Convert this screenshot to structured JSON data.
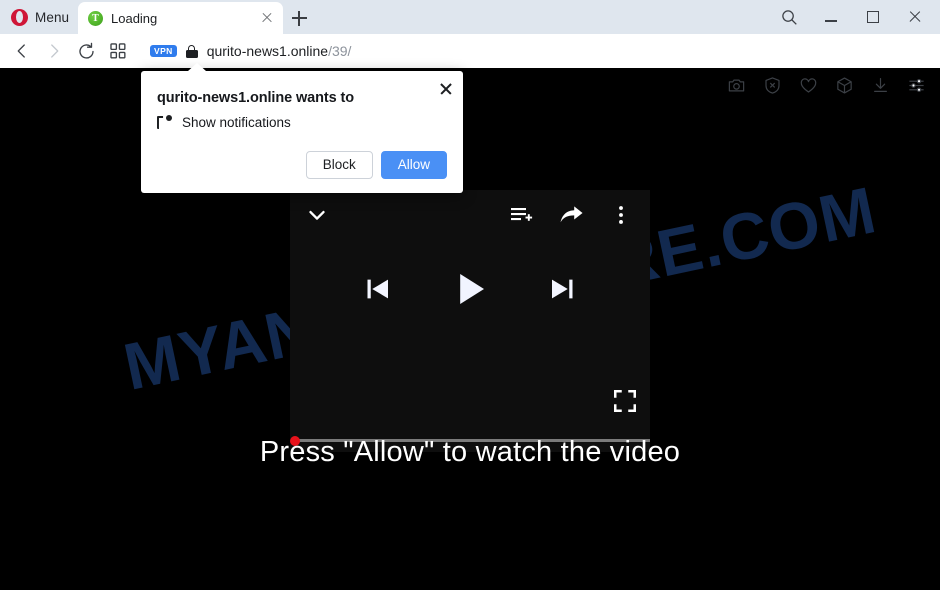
{
  "browser": {
    "name": "Opera",
    "menu_label": "Menu",
    "tab": {
      "title": "Loading",
      "favicon_letter": "T",
      "favicon_color": "#4caf28",
      "close_icon": "close-icon"
    },
    "new_tab_icon": "plus-icon",
    "window_controls": {
      "search_icon": "search-icon",
      "minimize_icon": "minimize-icon",
      "maximize_icon": "maximize-icon",
      "close_icon": "close-icon"
    },
    "navigation": {
      "back_icon": "chevron-left-icon",
      "forward_icon": "chevron-right-icon",
      "reload_icon": "reload-icon",
      "tab_islands_icon": "grid-icon"
    },
    "address": {
      "vpn_badge": "VPN",
      "vpn_badge_color": "#2f7ced",
      "lock_icon": "lock-icon",
      "host": "qurito-news1.online",
      "path": "/39/"
    },
    "toolbar_icons": [
      {
        "name": "snapshot-icon"
      },
      {
        "name": "ad-blocker-icon"
      },
      {
        "name": "heart-icon"
      },
      {
        "name": "web3-cube-icon"
      },
      {
        "name": "downloads-icon"
      },
      {
        "name": "easy-setup-icon"
      }
    ]
  },
  "permission_dialog": {
    "title": "qurito-news1.online wants to",
    "permission_icon": "notification-icon",
    "permission_label": "Show notifications",
    "block_label": "Block",
    "allow_label": "Allow",
    "allow_color": "#4a90f5",
    "close_icon": "close-icon"
  },
  "page": {
    "background_color": "#000000",
    "watermark": "MYANTISPYWARE.COM",
    "watermark_color": "#12294f",
    "cta_text": "Press \"Allow\" to watch the video",
    "player": {
      "background_color": "#0e0e0e",
      "collapse_icon": "chevron-down-icon",
      "queue_icon": "add-to-queue-icon",
      "share_icon": "share-arrow-icon",
      "more_icon": "kebab-menu-icon",
      "previous_icon": "skip-previous-icon",
      "play_icon": "play-icon",
      "next_icon": "skip-next-icon",
      "fullscreen_icon": "fullscreen-icon",
      "progress_percent": 0,
      "progress_dot_color": "#e8121b"
    }
  }
}
